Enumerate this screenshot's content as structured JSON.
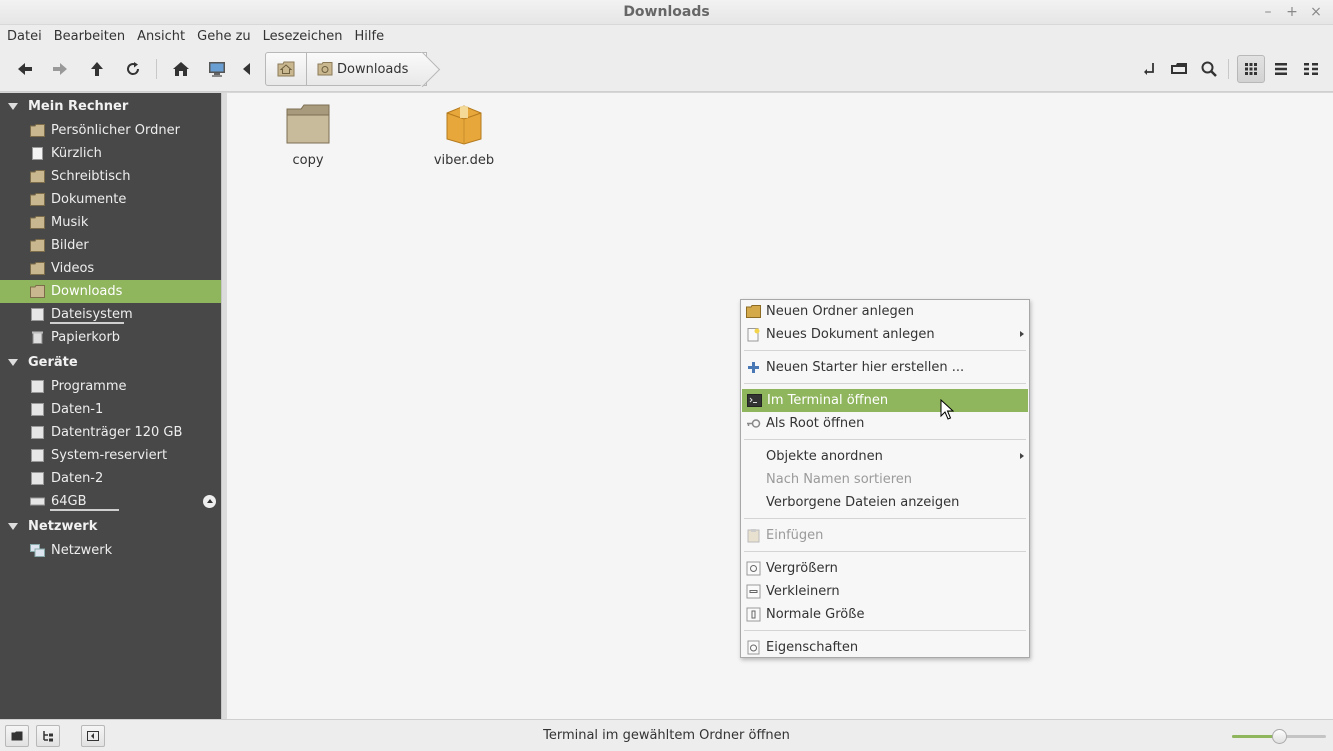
{
  "window": {
    "title": "Downloads"
  },
  "menubar": [
    "Datei",
    "Bearbeiten",
    "Ansicht",
    "Gehe zu",
    "Lesezeichen",
    "Hilfe"
  ],
  "breadcrumb": {
    "current": "Downloads"
  },
  "sidebar": {
    "sections": [
      {
        "title": "Mein Rechner",
        "items": [
          "Persönlicher Ordner",
          "Kürzlich",
          "Schreibtisch",
          "Dokumente",
          "Musik",
          "Bilder",
          "Videos",
          "Downloads",
          "Dateisystem",
          "Papierkorb"
        ]
      },
      {
        "title": "Geräte",
        "items": [
          "Programme",
          "Daten-1",
          "Datenträger 120 GB",
          "System-reserviert",
          "Daten-2",
          "64GB"
        ]
      },
      {
        "title": "Netzwerk",
        "items": [
          "Netzwerk"
        ]
      }
    ],
    "active_item": "Downloads"
  },
  "files": [
    {
      "name": "copy",
      "icon": "folder-icon"
    },
    {
      "name": "viber.deb",
      "icon": "package-icon"
    }
  ],
  "context_menu": {
    "items": [
      "Neuen Ordner anlegen",
      "Neues Dokument anlegen",
      "Neuen Starter hier erstellen ...",
      "Im Terminal öffnen",
      "Als Root öffnen",
      "Objekte anordnen",
      "Nach Namen sortieren",
      "Verborgene Dateien anzeigen",
      "Einfügen",
      "Vergrößern",
      "Verkleinern",
      "Normale Größe",
      "Eigenschaften"
    ],
    "highlighted": "Im Terminal öffnen"
  },
  "statusbar": {
    "text": "Terminal im gewähltem Ordner öffnen",
    "zoom_level": 0.5
  },
  "colors": {
    "accent": "#8fb55d",
    "sidebar_bg": "#484848",
    "content_bg": "#f5f5f5"
  }
}
